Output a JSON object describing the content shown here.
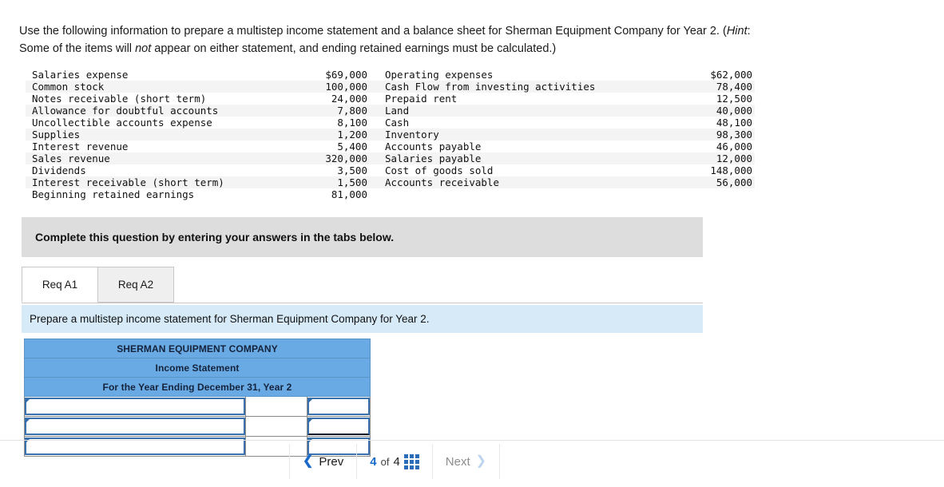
{
  "question": {
    "line1_a": "Use the following information to prepare a multistep income statement and a balance sheet for Sherman Equipment Company for Year",
    "line2_a": "2. (",
    "hint_label": "Hint",
    "line2_b": ": Some of the items will ",
    "not_label": "not",
    "line2_c": " appear on either statement, and ending retained earnings must be calculated.)"
  },
  "given_data": {
    "left": [
      {
        "label": "Salaries expense",
        "value": "$69,000"
      },
      {
        "label": "Common stock",
        "value": "100,000"
      },
      {
        "label": "Notes receivable (short term)",
        "value": "24,000"
      },
      {
        "label": "Allowance for doubtful accounts",
        "value": "7,800"
      },
      {
        "label": "Uncollectible accounts expense",
        "value": "8,100"
      },
      {
        "label": "Supplies",
        "value": "1,200"
      },
      {
        "label": "Interest revenue",
        "value": "5,400"
      },
      {
        "label": "Sales revenue",
        "value": "320,000"
      },
      {
        "label": "Dividends",
        "value": "3,500"
      },
      {
        "label": "Interest receivable (short term)",
        "value": "1,500"
      },
      {
        "label": "Beginning retained earnings",
        "value": "81,000"
      }
    ],
    "right": [
      {
        "label": "Operating expenses",
        "value": "$62,000"
      },
      {
        "label": "Cash Flow from investing activities",
        "value": "78,400"
      },
      {
        "label": "Prepaid rent",
        "value": "12,500"
      },
      {
        "label": "Land",
        "value": "40,000"
      },
      {
        "label": "Cash",
        "value": "48,100"
      },
      {
        "label": "Inventory",
        "value": "98,300"
      },
      {
        "label": "Accounts payable",
        "value": "46,000"
      },
      {
        "label": "Salaries payable",
        "value": "12,000"
      },
      {
        "label": "Cost of goods sold",
        "value": "148,000"
      },
      {
        "label": "Accounts receivable",
        "value": "56,000"
      },
      {
        "label": "",
        "value": ""
      }
    ]
  },
  "instruction_band": {
    "text": "Complete this question by entering your answers in the tabs below."
  },
  "tabs": [
    {
      "label": "Req A1",
      "active": true
    },
    {
      "label": "Req A2",
      "active": false
    }
  ],
  "requirement_band": {
    "text": "Prepare a multistep income statement for Sherman Equipment Company for Year 2."
  },
  "answer_sheet": {
    "header_rows": [
      "SHERMAN EQUIPMENT COMPANY",
      "Income Statement",
      "For the Year Ending December 31, Year 2"
    ],
    "input_rows": [
      {
        "label_value": "",
        "mid_value": "",
        "right_value": ""
      },
      {
        "label_value": "",
        "mid_value": "",
        "right_value": ""
      },
      {
        "label_value": "",
        "mid_value": "",
        "right_value": ""
      }
    ]
  },
  "navigation": {
    "prev_label": "Prev",
    "prev_icon": "chevron-left-icon",
    "current_page": "4",
    "of_label": "of",
    "total_pages": "4",
    "grid_icon": "grid-view-icon",
    "next_label": "Next",
    "next_icon": "chevron-right-icon"
  },
  "colors": {
    "header_blue": "#6aaae4",
    "band_blue": "#d6eaf8",
    "band_gray": "#dddddd",
    "accent_blue": "#1b6ac9",
    "field_border": "#3a72ad"
  }
}
